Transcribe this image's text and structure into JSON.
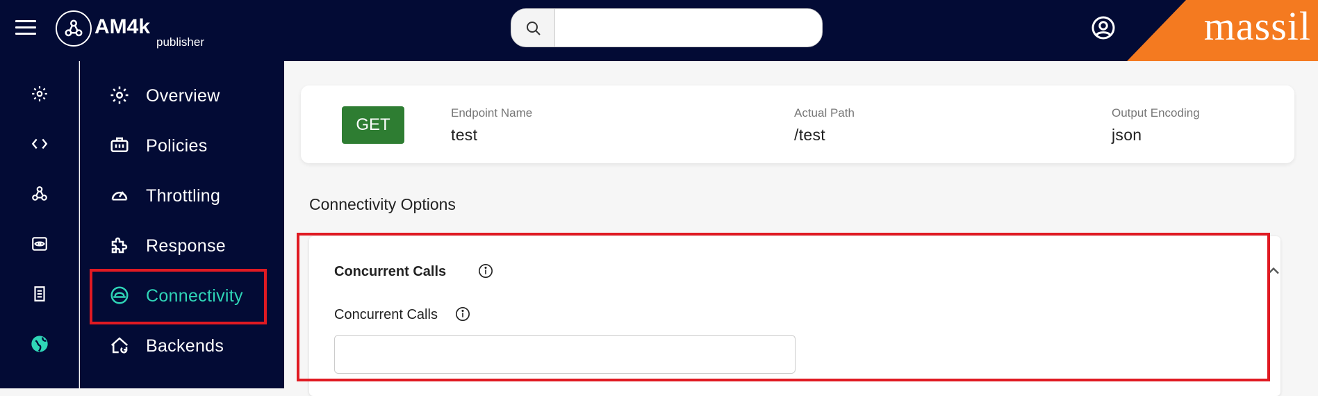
{
  "app": {
    "logo_text": "AM4k",
    "logo_sub": "publisher",
    "brand": "massil"
  },
  "search": {
    "placeholder": "",
    "value": ""
  },
  "nav": {
    "items": [
      {
        "label": "Overview",
        "icon": "gear-icon"
      },
      {
        "label": "Policies",
        "icon": "policies-icon"
      },
      {
        "label": "Throttling",
        "icon": "speedometer-icon"
      },
      {
        "label": "Response",
        "icon": "puzzle-icon"
      },
      {
        "label": "Connectivity",
        "icon": "connectivity-icon",
        "active": true
      },
      {
        "label": "Backends",
        "icon": "backend-icon"
      }
    ]
  },
  "endpoint": {
    "method": "GET",
    "name_label": "Endpoint Name",
    "name_value": "test",
    "path_label": "Actual Path",
    "path_value": "/test",
    "encoding_label": "Output Encoding",
    "encoding_value": "json"
  },
  "connectivity": {
    "section_title": "Connectivity Options",
    "panel_title": "Concurrent Calls",
    "field_label": "Concurrent Calls",
    "field_value": ""
  },
  "colors": {
    "topbar": "#030b35",
    "accent": "#2fd5b7",
    "brand": "#f47a20",
    "get_badge": "#2e7d32",
    "highlight": "#e01a22"
  }
}
